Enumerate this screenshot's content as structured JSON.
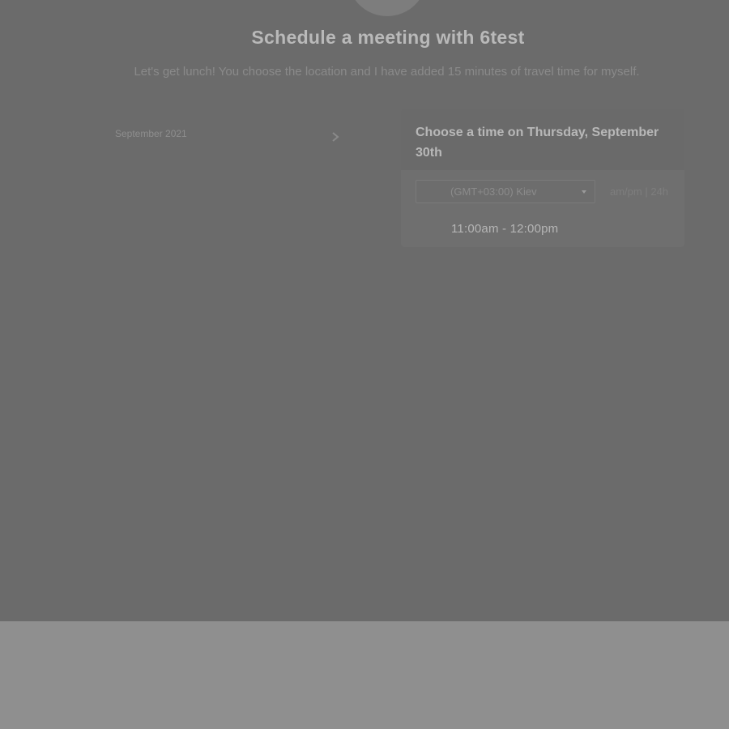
{
  "header": {
    "title": "Schedule a meeting with 6test",
    "description": "Let's get lunch! You choose the location and I have added 15 minutes of travel time for myself."
  },
  "calendar": {
    "month_label": "September 2021",
    "next_icon": "chevron-right-icon"
  },
  "time_panel": {
    "title": "Choose a time on Thursday, September 30th",
    "timezone": "(GMT+03:00) Kiev",
    "format_ampm": "am/pm",
    "format_separator": " | ",
    "format_24h": "24h",
    "slots": [
      "11:00am - 12:00pm"
    ]
  },
  "colors": {
    "overlay": "#6b6b6b",
    "page": "#8f8f8f"
  }
}
